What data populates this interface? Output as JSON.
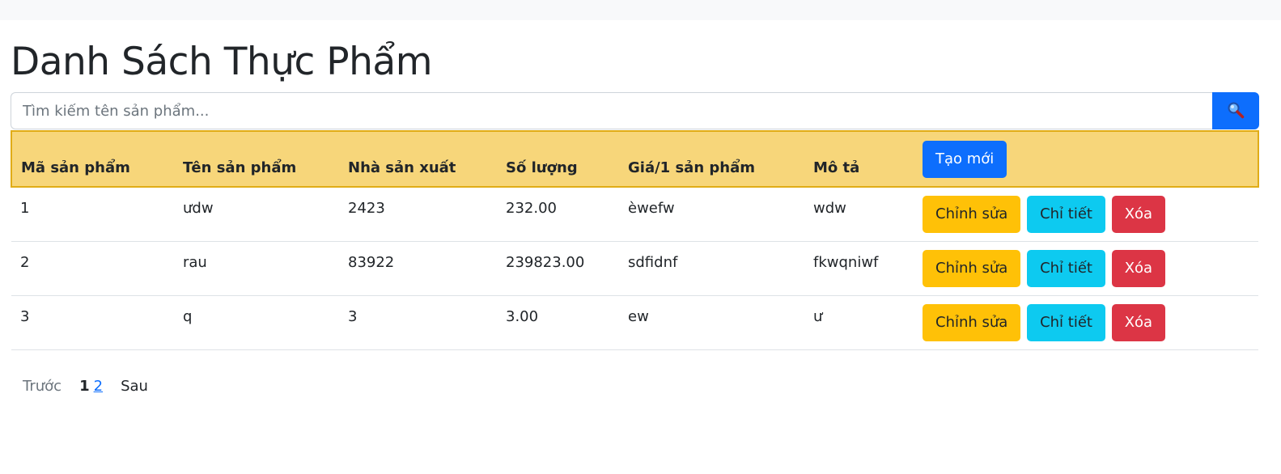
{
  "page": {
    "title": "Danh Sách Thực Phẩm"
  },
  "search": {
    "placeholder": "Tìm kiếm tên sản phẩm...",
    "value": "",
    "button_icon": "magnifier-icon"
  },
  "table": {
    "columns": [
      "Mã sản phẩm",
      "Tên sản phẩm",
      "Nhà sản xuất",
      "Số lượng",
      "Giá/1 sản phẩm",
      "Mô tả"
    ],
    "create_label": "Tạo mới",
    "rows": [
      {
        "id": "1",
        "name": "ưdw",
        "manufacturer": "2423",
        "quantity": "232.00",
        "price": "èwefw",
        "description": "wdw"
      },
      {
        "id": "2",
        "name": "rau",
        "manufacturer": "83922",
        "quantity": "239823.00",
        "price": "sdfidnf",
        "description": "fkwqniwf"
      },
      {
        "id": "3",
        "name": "q",
        "manufacturer": "3",
        "quantity": "3.00",
        "price": "ew",
        "description": "ư"
      }
    ],
    "actions": {
      "edit_label": "Chỉnh sửa",
      "detail_label": "Chỉ tiết",
      "delete_label": "Xóa"
    }
  },
  "pagination": {
    "prev_label": "Trước",
    "current_page": "1",
    "pages": [
      "2"
    ],
    "next_label": "Sau"
  },
  "colors": {
    "primary": "#0d6efd",
    "warning": "#ffc107",
    "info": "#0dcaf0",
    "danger": "#dc3545",
    "header_bg": "#f7d67a",
    "header_border": "#e0ac17"
  }
}
